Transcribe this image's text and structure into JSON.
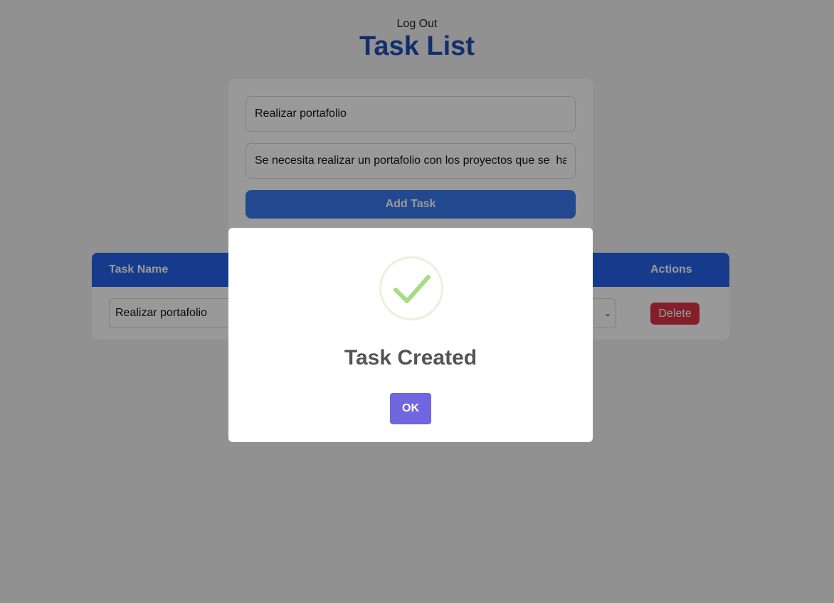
{
  "header": {
    "logout_label": "Log Out",
    "title": "Task List"
  },
  "form": {
    "task_name_value": "Realizar portafolio",
    "description_value": "Se necesita realizar un portafolio con los proyectos que se  hay",
    "add_button_label": "Add Task"
  },
  "table": {
    "columns": [
      "Task Name",
      "Actions"
    ],
    "rows": [
      {
        "task_name": "Realizar portafolio",
        "delete_label": "Delete"
      }
    ]
  },
  "modal": {
    "icon": "success-check-icon",
    "title": "Task Created",
    "ok_label": "OK"
  },
  "colors": {
    "title": "#1e4db7",
    "primary_button": "#3a7bef",
    "table_header": "#2563eb",
    "delete_button": "#dc3545",
    "modal_ok": "#7066e0",
    "success_check": "#a5dc86"
  }
}
